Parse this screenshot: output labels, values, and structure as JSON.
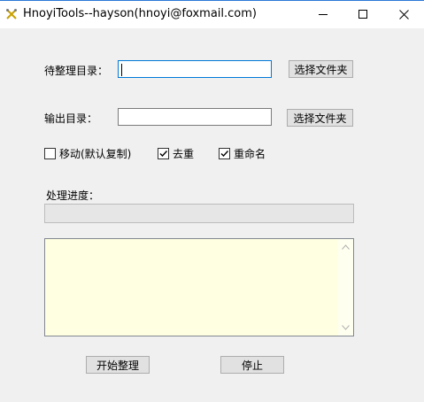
{
  "window": {
    "title": "HnoyiTools--hayson(hnoyi@foxmail.com)",
    "icon": "tools-app-icon",
    "controls": [
      "minimize-icon",
      "maximize-icon",
      "close-icon"
    ]
  },
  "form": {
    "source_dir_label": "待整理目录：",
    "source_dir_value": "",
    "output_dir_label": "输出目录：",
    "output_dir_value": "",
    "browse_button_label": "选择文件夹",
    "options": [
      {
        "label": "移动(默认复制)",
        "checked": false
      },
      {
        "label": "去重",
        "checked": true
      },
      {
        "label": "重命名",
        "checked": true
      }
    ],
    "progress_label": "处理进度：",
    "progress_value": 0,
    "log_text": ""
  },
  "actions": {
    "start_label": "开始整理",
    "stop_label": "停止"
  },
  "colors": {
    "title_accent": "#2b78d8",
    "focus_border": "#0078d7",
    "log_background": "#ffffe1",
    "button_face": "#e1e1e1",
    "progress_fill": "#06b025"
  }
}
